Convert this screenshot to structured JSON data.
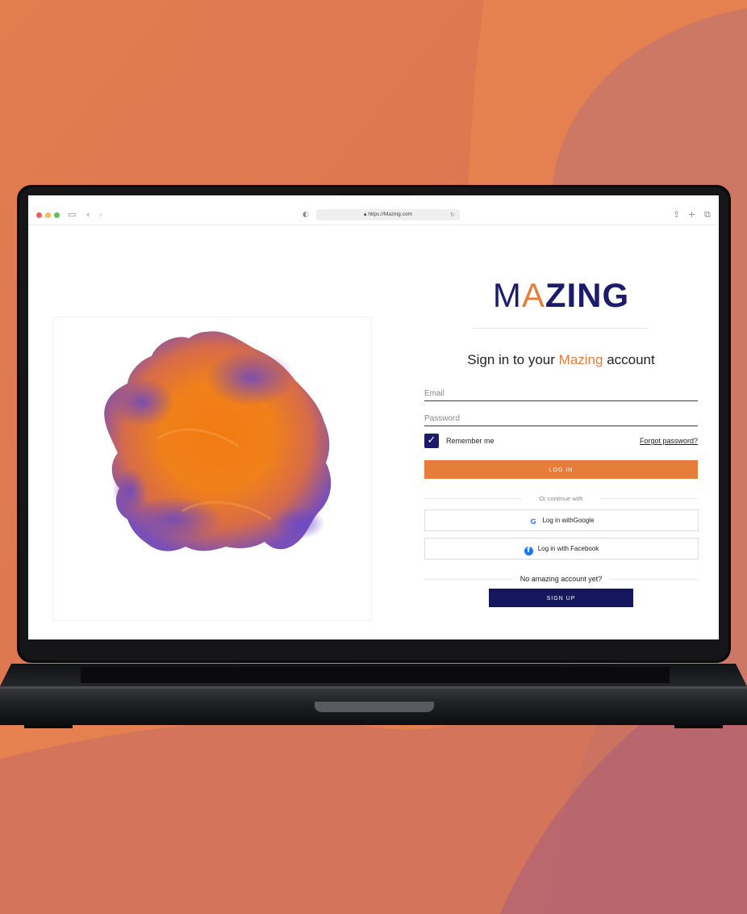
{
  "colors": {
    "accent": "#e77d3b",
    "brand_navy": "#1d1b6b",
    "signup_navy": "#15175f",
    "background_orange": "#e58450"
  },
  "browser": {
    "url": "https://Mazing.com",
    "icons": [
      "traffic-lights",
      "sidebar-icon",
      "back-icon",
      "forward-icon",
      "shield-icon",
      "lock-icon",
      "reload-icon",
      "share-icon",
      "new-tab-icon",
      "tabs-icon"
    ]
  },
  "login": {
    "logo": {
      "m": "M",
      "a": "A",
      "rest": "ZING"
    },
    "heading_prefix": "Sign in to your ",
    "heading_brand": "Mazing",
    "heading_suffix": " account",
    "email_placeholder": "Email",
    "password_placeholder": "Password",
    "remember_label": "Remember me",
    "remember_checked": true,
    "forgot_label": "Forgot password?",
    "login_button": "LOG IN",
    "or_continue": "Or continue with",
    "google_button": "Log in withGoogle",
    "facebook_button": "Log in with Facebook",
    "no_account": "No amazing account yet?",
    "signup_button": "SIGN UP"
  }
}
